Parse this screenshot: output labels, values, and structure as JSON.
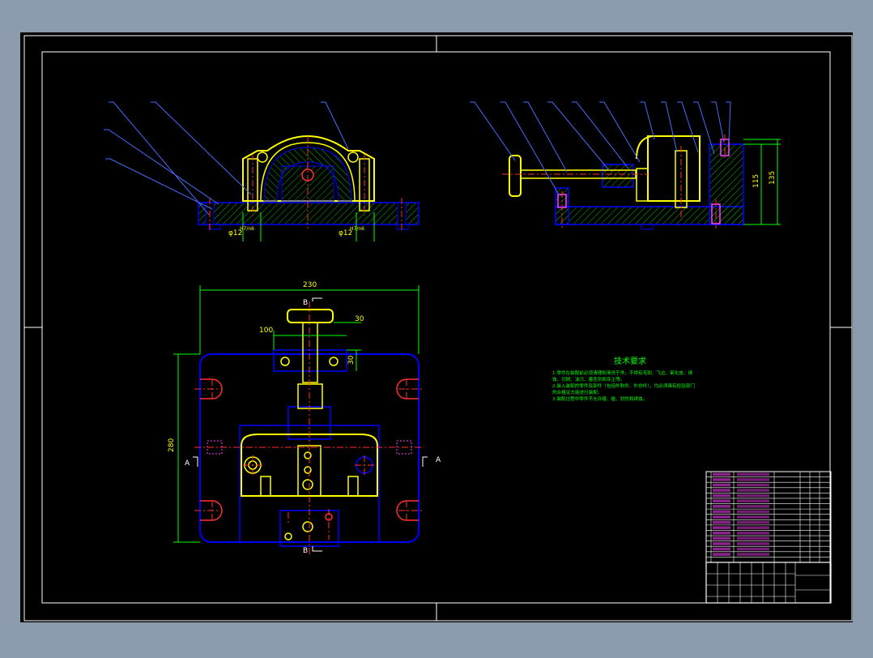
{
  "colors": {
    "viewport": "#8d9bae",
    "sheet": "#000000",
    "frame": "#ffffff",
    "outline": "#0000ff",
    "hatch": "#00b800",
    "part": "#ffff00",
    "center": "#ff3030",
    "dim": "#00ff00",
    "leader": "#4a6bff",
    "magenta": "#ff40ff",
    "note": "#00ff00"
  },
  "dimensions": {
    "phi_left": "φ12",
    "phi_left_tol": "H7/n6",
    "phi_right": "φ12",
    "phi_right_tol": "H7/n6",
    "height_outer": "135",
    "height_inner": "115",
    "width_top": "230",
    "depth_left": "280",
    "slot_width": "100",
    "offset_30": "30",
    "side_30": "30"
  },
  "section_marks": {
    "b_top": "B",
    "b_bottom": "B",
    "a_left": "A",
    "a_right": "A"
  },
  "notes": {
    "title": "技术要求",
    "lines": [
      "1.零件在装配前必须清理和清洗干净，不得有毛刺、飞边、氧化皮、锈",
      "蚀、切屑、油污、着色剂和灰尘等。",
      "2.装入装配的零件及部件（包括外购件、外协件），均必须具有检验部门",
      "的合格证方能进行装配。",
      "3.装配过程中零件不允许磕、碰、划伤和锈蚀。"
    ]
  }
}
